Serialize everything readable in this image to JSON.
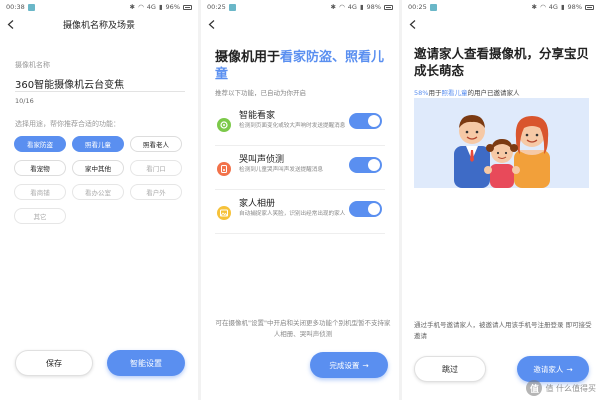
{
  "colors": {
    "accent": "#5a8ff0",
    "illustration_bg": "#dfeafb"
  },
  "screen1": {
    "status": {
      "time": "00:38",
      "signal": "4G",
      "battery": "96%"
    },
    "title": "摄像机名称及场景",
    "name_label": "摄像机名称",
    "name_value": "360智能摄像机云台变焦",
    "counter": "10/16",
    "usage_hint": "选择用途，帮你推荐合适的功能：",
    "chips": [
      {
        "label": "看家防盗",
        "state": "selected"
      },
      {
        "label": "照看儿童",
        "state": "selected"
      },
      {
        "label": "照看老人",
        "state": "normal"
      },
      {
        "label": "看宠物",
        "state": "normal"
      },
      {
        "label": "家中其他",
        "state": "normal"
      },
      {
        "label": "看门口",
        "state": "dim"
      },
      {
        "label": "看商铺",
        "state": "dim"
      },
      {
        "label": "看办公室",
        "state": "dim"
      },
      {
        "label": "看户外",
        "state": "dim"
      },
      {
        "label": "其它",
        "state": "dim"
      }
    ],
    "save_label": "保存",
    "smart_label": "智能设置"
  },
  "screen2": {
    "status": {
      "time": "00:25",
      "signal": "4G",
      "battery": "98%"
    },
    "heading_prefix": "摄像机用于",
    "heading_highlight": "看家防盗、照看儿童",
    "subtitle": "推荐以下功能，已自动为你开启",
    "features": [
      {
        "title": "智能看家",
        "desc": "检测到页面变化或较大声响时发送提醒消息",
        "icon": "home-guard-icon",
        "enabled": true
      },
      {
        "title": "哭叫声侦测",
        "desc": "检测到儿童哭声叫声发送提醒消息",
        "icon": "cry-detect-icon",
        "enabled": true
      },
      {
        "title": "家人相册",
        "desc": "自动捕捉家人笑脸，识别出经常出现的家人",
        "icon": "family-album-icon",
        "enabled": true
      }
    ],
    "footer_note": "可在摄像机\"设置\"中开启和关闭更多功能个别机型暂不支持家人相册、哭叫声侦测",
    "done_label": "完成设置"
  },
  "screen3": {
    "status": {
      "time": "00:25",
      "signal": "4G",
      "battery": "98%"
    },
    "heading": "邀请家人查看摄像机，分享宝贝成长萌态",
    "sub_percent": "58%",
    "sub_mid": "用于",
    "sub_highlight": "照看儿童",
    "sub_suffix": "的用户已邀请家人",
    "footer_note": "通过手机号邀请家人，被邀请人用该手机号注册登录 即可接受邀请",
    "skip_label": "跳过",
    "invite_label": "邀请家人",
    "watermark": "值 什么值得买"
  }
}
